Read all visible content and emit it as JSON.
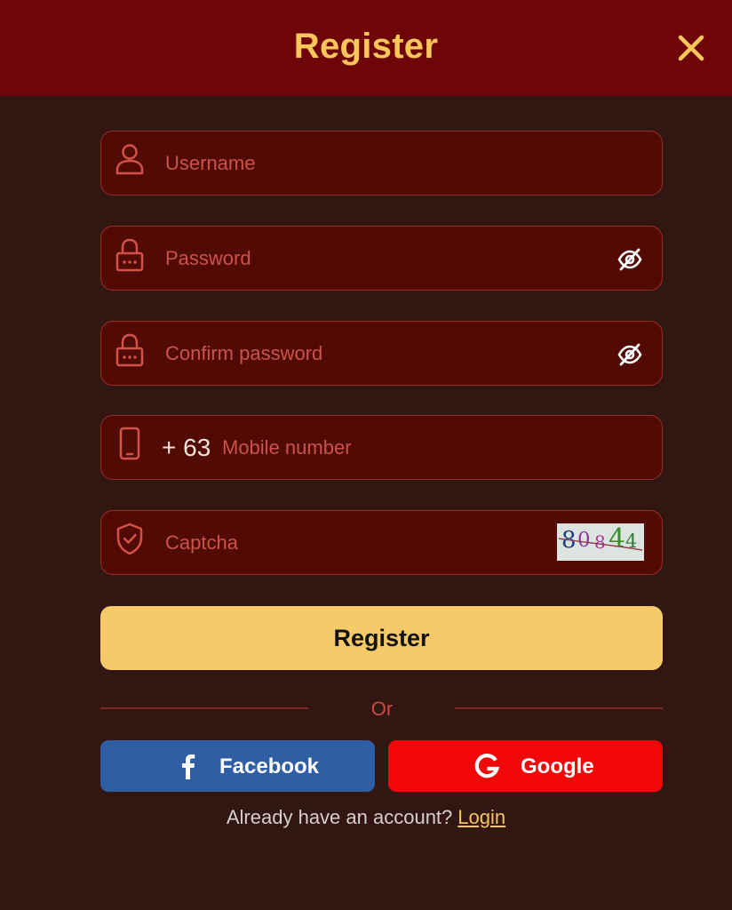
{
  "header": {
    "title": "Register",
    "close_icon": "close-icon"
  },
  "form": {
    "username": {
      "placeholder": "Username",
      "icon": "user-icon"
    },
    "password": {
      "placeholder": "Password",
      "icon": "lock-icon",
      "toggle_icon": "eye-off-icon"
    },
    "confirm_password": {
      "placeholder": "Confirm password",
      "icon": "lock-icon",
      "toggle_icon": "eye-off-icon"
    },
    "mobile": {
      "prefix": "+ 63",
      "placeholder": "Mobile number",
      "icon": "phone-icon"
    },
    "captcha": {
      "placeholder": "Captcha",
      "icon": "shield-check-icon",
      "code": [
        "8",
        "0",
        "8",
        "4",
        "4"
      ]
    }
  },
  "register_button": "Register",
  "divider_text": "Or",
  "social": {
    "facebook": {
      "label": "Facebook",
      "icon": "facebook-icon",
      "color": "#2f5ea4"
    },
    "google": {
      "label": "Google",
      "icon": "google-icon",
      "color": "#f10708"
    }
  },
  "footer": {
    "prompt": "Already have an account?",
    "login_label": "Login"
  },
  "colors": {
    "background": "#311612",
    "header": "#6e0509",
    "accent": "#fbc65a",
    "field_bg": "#520a05",
    "field_border": "#9b2f27",
    "button": "#f6ca69"
  }
}
